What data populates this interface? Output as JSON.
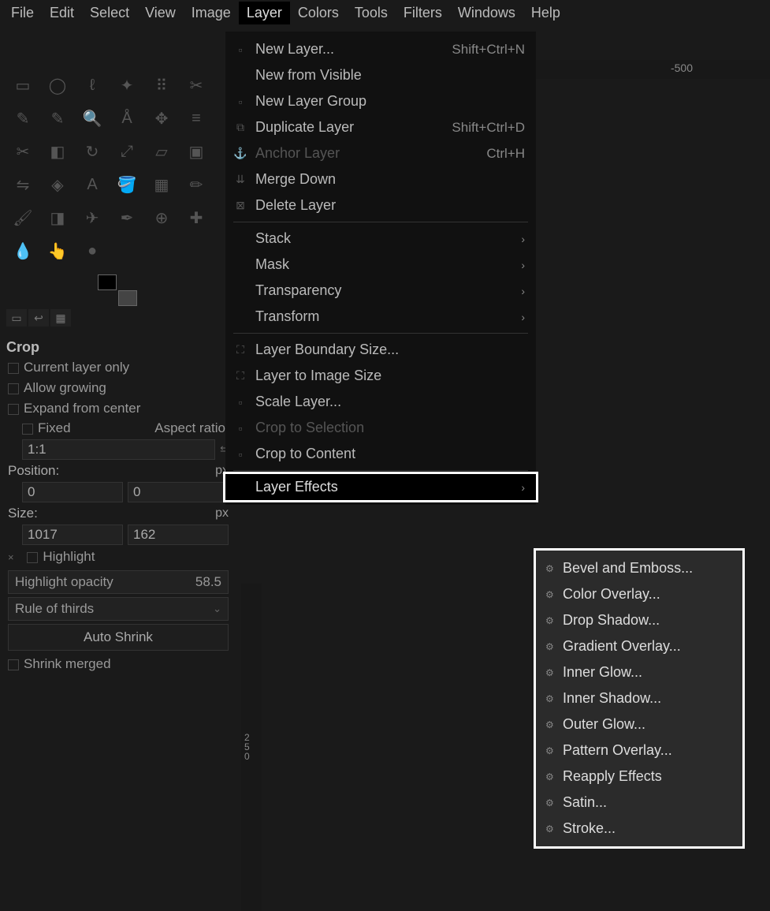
{
  "menubar": [
    "File",
    "Edit",
    "Select",
    "View",
    "Image",
    "Layer",
    "Colors",
    "Tools",
    "Filters",
    "Windows",
    "Help"
  ],
  "active_menu_index": 5,
  "layer_menu": [
    {
      "type": "item",
      "icon": "▫",
      "label": "New Layer...",
      "accel": "Shift+Ctrl+N"
    },
    {
      "type": "item",
      "icon": "",
      "label": "New from Visible"
    },
    {
      "type": "item",
      "icon": "▫",
      "label": "New Layer Group"
    },
    {
      "type": "item",
      "icon": "⧉",
      "label": "Duplicate Layer",
      "accel": "Shift+Ctrl+D"
    },
    {
      "type": "item",
      "icon": "⚓",
      "label": "Anchor Layer",
      "accel": "Ctrl+H",
      "disabled": true
    },
    {
      "type": "item",
      "icon": "⇊",
      "label": "Merge Down"
    },
    {
      "type": "item",
      "icon": "⊠",
      "label": "Delete Layer"
    },
    {
      "type": "sep"
    },
    {
      "type": "sub",
      "label": "Stack"
    },
    {
      "type": "sub",
      "label": "Mask"
    },
    {
      "type": "sub",
      "label": "Transparency"
    },
    {
      "type": "sub",
      "label": "Transform"
    },
    {
      "type": "sep"
    },
    {
      "type": "item",
      "icon": "⛶",
      "label": "Layer Boundary Size..."
    },
    {
      "type": "item",
      "icon": "⛶",
      "label": "Layer to Image Size"
    },
    {
      "type": "item",
      "icon": "▫",
      "label": "Scale Layer..."
    },
    {
      "type": "item",
      "icon": "▫",
      "label": "Crop to Selection",
      "disabled": true
    },
    {
      "type": "item",
      "icon": "▫",
      "label": "Crop to Content"
    },
    {
      "type": "sep"
    },
    {
      "type": "sub",
      "label": "Layer Effects",
      "hovered": true
    }
  ],
  "layer_effects": [
    "Bevel and Emboss...",
    "Color Overlay...",
    "Drop Shadow...",
    "Gradient Overlay...",
    "Inner Glow...",
    "Inner Shadow...",
    "Outer Glow...",
    "Pattern Overlay...",
    "Reapply Effects",
    "Satin...",
    "Stroke..."
  ],
  "ruler": {
    "h_label": "-500",
    "v_labels": [
      "2",
      "5",
      "0"
    ]
  },
  "tool_options": {
    "title": "Crop",
    "chk_current_layer": "Current layer only",
    "chk_allow_growing": "Allow growing",
    "chk_expand_center": "Expand from center",
    "fixed_label": "Fixed",
    "fixed_mode": "Aspect ratio",
    "ratio": "1:1",
    "position_label": "Position:",
    "position_unit": "px",
    "pos_x": "0",
    "pos_y": "0",
    "size_label": "Size:",
    "size_unit": "px",
    "size_w": "1017",
    "size_h": "162",
    "highlight_label": "Highlight",
    "highlight_opacity_label": "Highlight opacity",
    "highlight_opacity_value": "58.5",
    "guides": "Rule of thirds",
    "auto_shrink": "Auto Shrink",
    "shrink_merged": "Shrink merged"
  }
}
